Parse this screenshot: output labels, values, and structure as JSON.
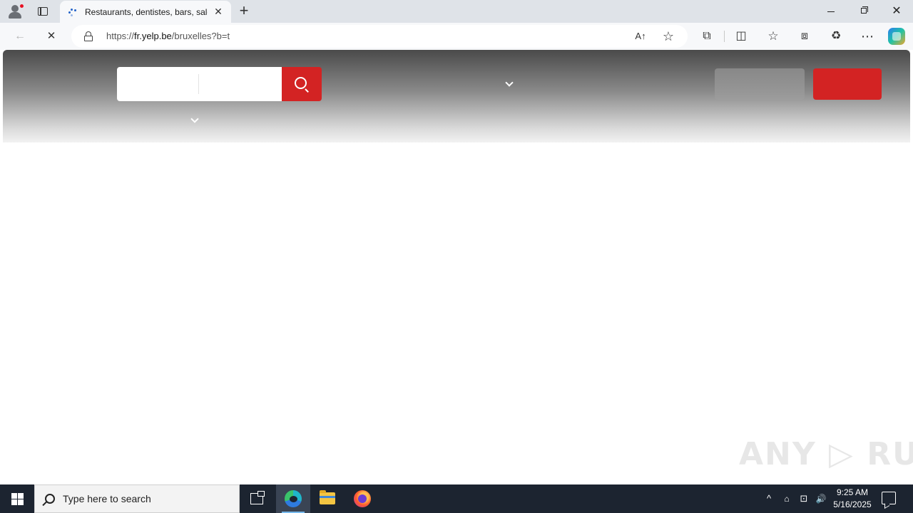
{
  "browser": {
    "tab": {
      "title": "Restaurants, dentistes, bars, salons de beauté, médecins",
      "close_glyph": "✕"
    },
    "new_tab_glyph": "+",
    "window_controls": {
      "close_glyph": "✕"
    },
    "nav": {
      "back_glyph": "←",
      "stop_glyph": "✕"
    },
    "address": {
      "scheme": "https://",
      "host": "fr.yelp.be",
      "path": "/bruxelles?b=t"
    },
    "icons": {
      "read_aloud": "A↑",
      "favorite": "☆",
      "extensions": "⧉",
      "split": "◫",
      "favorites": "☆",
      "collections": "⧈",
      "performance": "♻",
      "more": "⋯"
    }
  },
  "page": {
    "search": {
      "find_placeholder": "",
      "near_placeholder": ""
    },
    "colors": {
      "brand_red": "#d32323"
    }
  },
  "watermark": {
    "text": "ANY ▷ RUN"
  },
  "taskbar": {
    "search_placeholder": "Type here to search",
    "tray": {
      "chevron": "^",
      "network": "⊡",
      "volume": "🔊"
    },
    "clock": {
      "time": "9:25 AM",
      "date": "5/16/2025"
    }
  }
}
